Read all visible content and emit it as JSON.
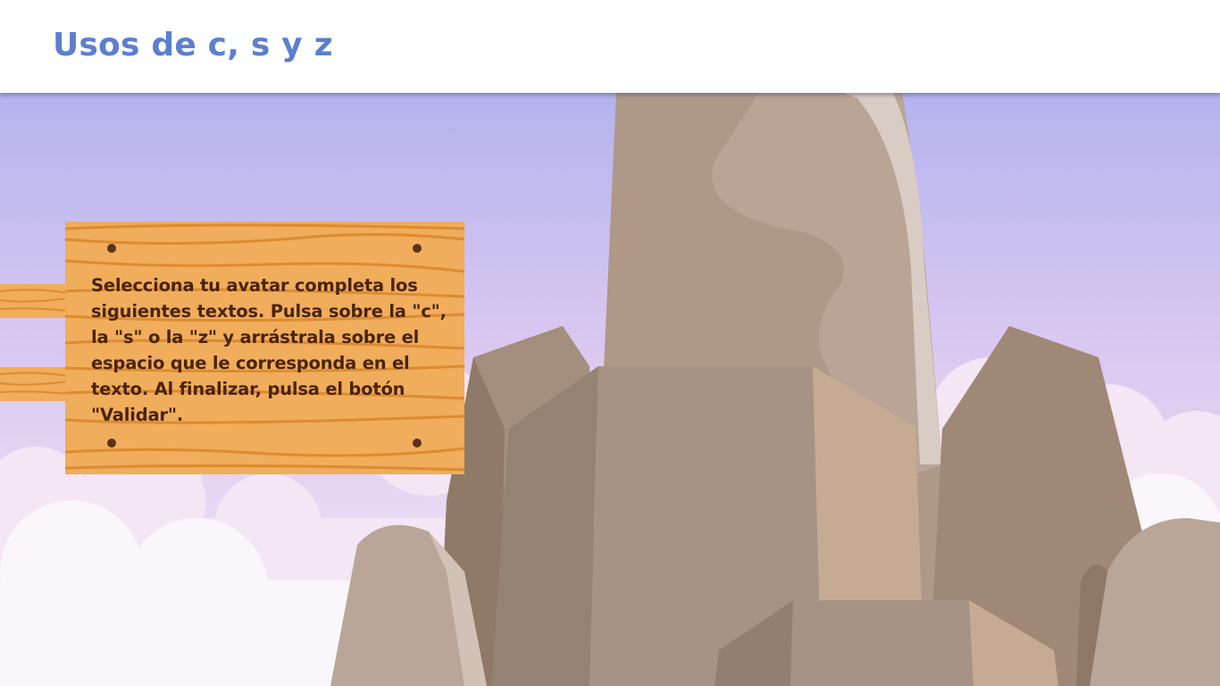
{
  "header": {
    "title": "Usos de c, s y z"
  },
  "sign": {
    "instructions": "Selecciona tu avatar completa los siguientes textos. Pulsa sobre la \"c\", la \"s\" o la \"z\" y arrástrala sobre el espacio que le corresponda en el texto. Al finalizar, pulsa el botón \"Validar\"."
  },
  "colors": {
    "title": "#5b7fcf",
    "sign_wood": "#f0ad5c",
    "sign_text": "#4a2408",
    "sky_top": "#b3b3ee",
    "rock": "#a89484"
  }
}
